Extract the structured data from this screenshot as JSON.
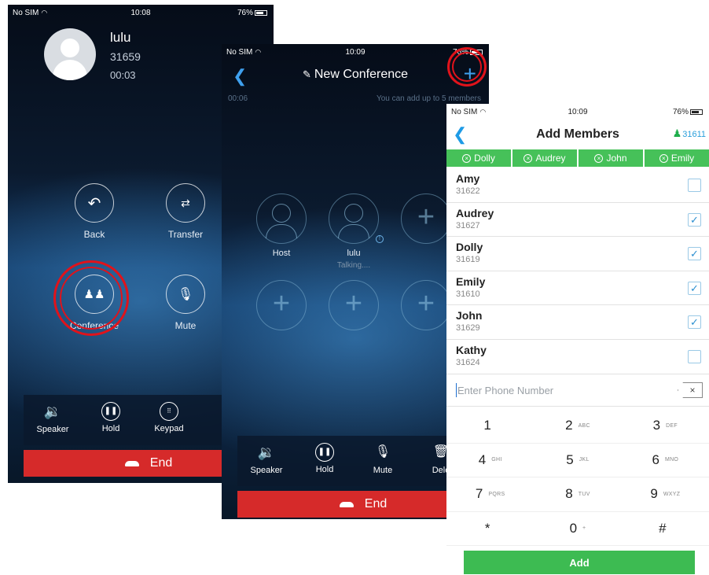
{
  "colors": {
    "accent_blue": "#3fa0ee",
    "end_red": "#d62a2a",
    "highlight_ring": "#e0131b",
    "chip_green": "#46c159",
    "add_green": "#3dbb52"
  },
  "screen1": {
    "status": {
      "carrier": "No SIM",
      "time": "10:08",
      "battery": "76%"
    },
    "caller": {
      "name": "lulu",
      "number": "31659",
      "duration": "00:03"
    },
    "buttons": {
      "back": "Back",
      "transfer": "Transfer",
      "conference": "Conference",
      "mute": "Mute"
    },
    "toolbar": {
      "speaker": "Speaker",
      "hold": "Hold",
      "keypad": "Keypad"
    },
    "end": "End"
  },
  "screen2": {
    "status": {
      "carrier": "No SIM",
      "time": "10:09",
      "battery": "76%"
    },
    "title": "New Conference",
    "duration": "00:06",
    "hint": "You can add up to 5 members",
    "participants": [
      {
        "name": "Host",
        "status": ""
      },
      {
        "name": "lulu",
        "status": "Talking...."
      }
    ],
    "toolbar": {
      "speaker": "Speaker",
      "hold": "Hold",
      "mute": "Mute",
      "delete": "Dele"
    },
    "end": "End"
  },
  "screen3": {
    "status": {
      "carrier": "No SIM",
      "time": "10:09",
      "battery": "76%"
    },
    "title": "Add Members",
    "selected_count": "31611",
    "chips": [
      "Dolly",
      "Audrey",
      "John",
      "Emily"
    ],
    "contacts": [
      {
        "name": "Amy",
        "number": "31622",
        "checked": false
      },
      {
        "name": "Audrey",
        "number": "31627",
        "checked": true
      },
      {
        "name": "Dolly",
        "number": "31619",
        "checked": true
      },
      {
        "name": "Emily",
        "number": "31610",
        "checked": true
      },
      {
        "name": "John",
        "number": "31629",
        "checked": true
      },
      {
        "name": "Kathy",
        "number": "31624",
        "checked": false
      }
    ],
    "phone_input": {
      "value": "",
      "placeholder": "Enter Phone Number"
    },
    "keypad": [
      {
        "digit": "1",
        "letters": ""
      },
      {
        "digit": "2",
        "letters": "ABC"
      },
      {
        "digit": "3",
        "letters": "DEF"
      },
      {
        "digit": "4",
        "letters": "GHI"
      },
      {
        "digit": "5",
        "letters": "JKL"
      },
      {
        "digit": "6",
        "letters": "MNO"
      },
      {
        "digit": "7",
        "letters": "PQRS"
      },
      {
        "digit": "8",
        "letters": "TUV"
      },
      {
        "digit": "9",
        "letters": "WXYZ"
      },
      {
        "digit": "*",
        "letters": ""
      },
      {
        "digit": "0",
        "letters": "+"
      },
      {
        "digit": "#",
        "letters": ""
      }
    ],
    "add_button": "Add"
  }
}
